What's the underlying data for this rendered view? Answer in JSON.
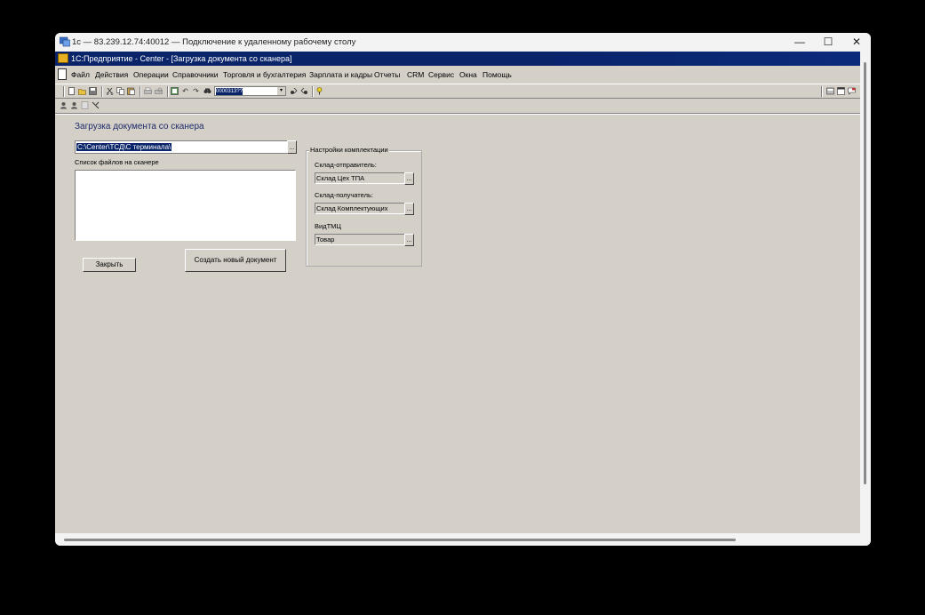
{
  "window": {
    "title": "1с — 83.239.12.74:40012 — Подключение к удаленному рабочему столу",
    "min_glyph": "—",
    "max_glyph": "☐",
    "close_glyph": "✕"
  },
  "app": {
    "title": "1С:Предприятие - Center - [Загрузка документа со сканера]"
  },
  "menu": {
    "items": [
      "Файл",
      "Действия",
      "Операции",
      "Справочники",
      "Торговля и бухгалтерия",
      "Зарплата и кадры",
      "Отчеты",
      "CRM",
      "Сервис",
      "Окна",
      "Помощь"
    ]
  },
  "toolbar": {
    "combo_value": "0000313??",
    "combo_arrow": "▾"
  },
  "form": {
    "title": "Загрузка документа со сканера",
    "path_value": "C:\\Center\\ТСД\\С терминала\\",
    "path_button": "...",
    "file_list_label": "Список файлов на сканере",
    "close_button": "Закрыть",
    "create_button": "Создать новый документ"
  },
  "settings": {
    "legend": "Настройки комплектации",
    "sender_label": "Склад-отправитель:",
    "sender_value": "Склад Цех ТПА",
    "receiver_label": "Склад-получатель:",
    "receiver_value": "Склад Комплектующих",
    "type_label": "ВидТМЦ",
    "type_value": "Товар",
    "select_button": "..."
  },
  "colors": {
    "app_bg": "#d4d0c8",
    "title_bar": "#0a246a",
    "form_title": "#1c2a6a"
  }
}
